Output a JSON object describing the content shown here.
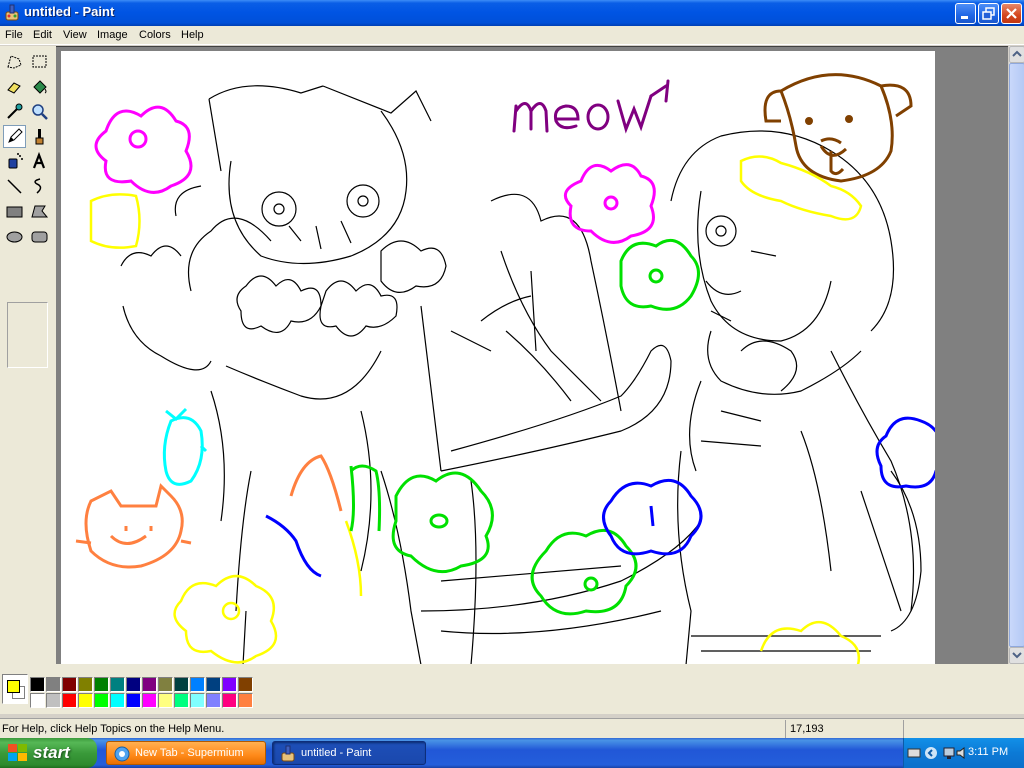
{
  "window": {
    "title": "untitled - Paint"
  },
  "menu": [
    "File",
    "Edit",
    "View",
    "Image",
    "Colors",
    "Help"
  ],
  "tools": [
    {
      "name": "free-form-select-icon"
    },
    {
      "name": "select-icon"
    },
    {
      "name": "eraser-icon"
    },
    {
      "name": "fill-with-color-icon"
    },
    {
      "name": "pick-color-icon"
    },
    {
      "name": "magnifier-icon"
    },
    {
      "name": "pencil-icon",
      "active": true
    },
    {
      "name": "brush-icon"
    },
    {
      "name": "airbrush-icon"
    },
    {
      "name": "text-icon"
    },
    {
      "name": "line-icon"
    },
    {
      "name": "curve-icon"
    },
    {
      "name": "rectangle-icon"
    },
    {
      "name": "polygon-icon"
    },
    {
      "name": "ellipse-icon"
    },
    {
      "name": "rounded-rectangle-icon"
    }
  ],
  "canvas": {
    "text": "meow",
    "colors": {
      "sketch": "#000000",
      "magenta": "#ff00ff",
      "purple": "#800080",
      "brown": "#804000",
      "yellow": "#ffff00",
      "green": "#00e000",
      "cyan": "#00ffff",
      "blue": "#0000ff",
      "orange": "#ff8040"
    }
  },
  "palette": {
    "primary": "#ffff00",
    "secondary": "#ffffff",
    "top_row": [
      "#000000",
      "#808080",
      "#800000",
      "#808000",
      "#008000",
      "#008080",
      "#000080",
      "#800080",
      "#808040",
      "#004040",
      "#0080ff",
      "#004080",
      "#8000ff",
      "#804000"
    ],
    "bottom_row": [
      "#ffffff",
      "#c0c0c0",
      "#ff0000",
      "#ffff00",
      "#00ff00",
      "#00ffff",
      "#0000ff",
      "#ff00ff",
      "#ffff80",
      "#00ff80",
      "#80ffff",
      "#8080ff",
      "#ff0080",
      "#ff8040"
    ]
  },
  "status": {
    "help": "For Help, click Help Topics on the Help Menu.",
    "coords": "17,193"
  },
  "taskbar": {
    "start": "start",
    "tasks": [
      {
        "label": "New Tab - Supermium"
      },
      {
        "label": "untitled - Paint"
      }
    ],
    "clock": "3:11 PM"
  }
}
